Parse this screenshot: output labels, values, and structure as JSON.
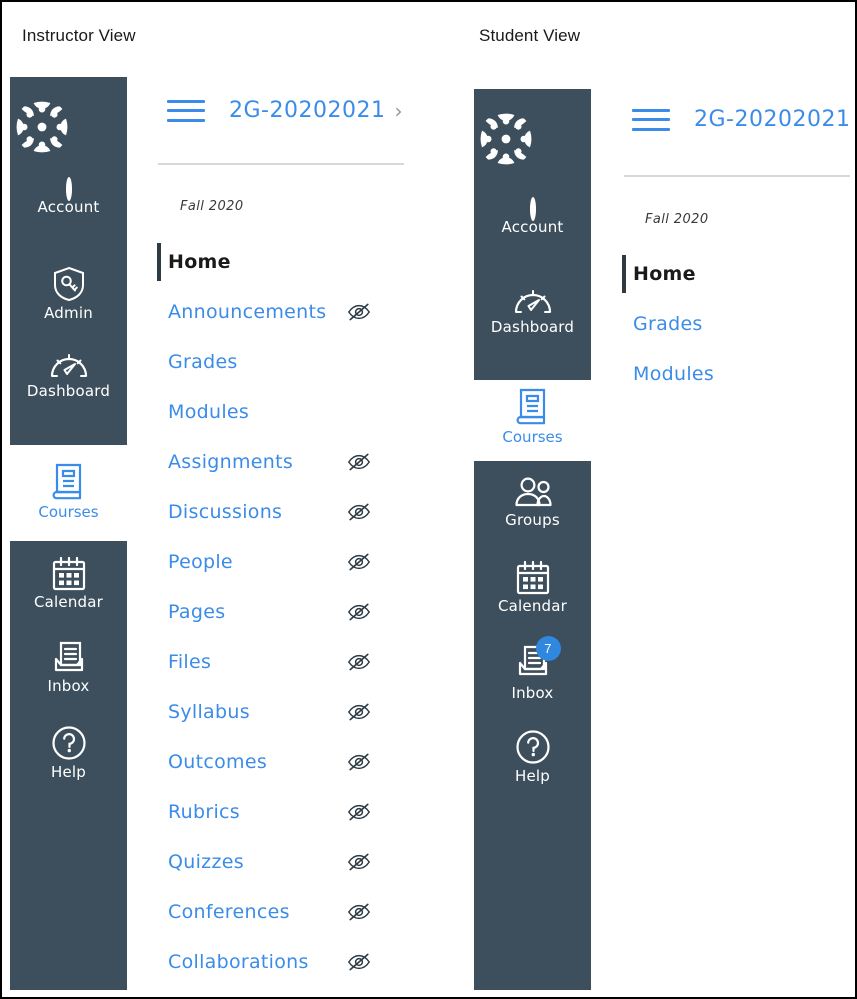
{
  "headings": {
    "instructor": "Instructor View",
    "student": "Student View"
  },
  "colors": {
    "nav_dark": "#3d4f5d",
    "link_blue": "#3b8ce8",
    "active_text": "#1a1a1a",
    "rule": "#d5d9dd",
    "badge": "#2f87e0",
    "chevron": "#8f9499"
  },
  "instructor": {
    "global_nav": {
      "logo_icon": "canvas-logo-icon",
      "items": [
        {
          "label": "Account",
          "icon": "avatar-icon",
          "active": false
        },
        {
          "label": "Admin",
          "icon": "shield-key-icon",
          "active": false
        },
        {
          "label": "Dashboard",
          "icon": "gauge-icon",
          "active": false
        },
        {
          "label": "Courses",
          "icon": "book-icon",
          "active": true
        },
        {
          "label": "Calendar",
          "icon": "calendar-icon",
          "active": false
        },
        {
          "label": "Inbox",
          "icon": "inbox-icon",
          "active": false
        },
        {
          "label": "Help",
          "icon": "question-circle-icon",
          "active": false
        }
      ]
    },
    "course": {
      "menu_icon": "hamburger-icon",
      "title": "2G-20202021",
      "chevron_icon": "chevron-right-icon",
      "has_chevron": true,
      "term": "Fall 2020",
      "nav": [
        {
          "label": "Home",
          "active": true,
          "hidden_icon": false
        },
        {
          "label": "Announcements",
          "active": false,
          "hidden_icon": true
        },
        {
          "label": "Grades",
          "active": false,
          "hidden_icon": false
        },
        {
          "label": "Modules",
          "active": false,
          "hidden_icon": false
        },
        {
          "label": "Assignments",
          "active": false,
          "hidden_icon": true
        },
        {
          "label": "Discussions",
          "active": false,
          "hidden_icon": true
        },
        {
          "label": "People",
          "active": false,
          "hidden_icon": true
        },
        {
          "label": "Pages",
          "active": false,
          "hidden_icon": true
        },
        {
          "label": "Files",
          "active": false,
          "hidden_icon": true
        },
        {
          "label": "Syllabus",
          "active": false,
          "hidden_icon": true
        },
        {
          "label": "Outcomes",
          "active": false,
          "hidden_icon": true
        },
        {
          "label": "Rubrics",
          "active": false,
          "hidden_icon": true
        },
        {
          "label": "Quizzes",
          "active": false,
          "hidden_icon": true
        },
        {
          "label": "Conferences",
          "active": false,
          "hidden_icon": true
        },
        {
          "label": "Collaborations",
          "active": false,
          "hidden_icon": true
        }
      ]
    }
  },
  "student": {
    "global_nav": {
      "logo_icon": "canvas-logo-icon",
      "items": [
        {
          "label": "Account",
          "icon": "avatar-icon",
          "active": false
        },
        {
          "label": "Dashboard",
          "icon": "gauge-icon",
          "active": false
        },
        {
          "label": "Courses",
          "icon": "book-icon",
          "active": true
        },
        {
          "label": "Groups",
          "icon": "groups-icon",
          "active": false
        },
        {
          "label": "Calendar",
          "icon": "calendar-icon",
          "active": false
        },
        {
          "label": "Inbox",
          "icon": "inbox-icon",
          "active": false,
          "badge": "7"
        },
        {
          "label": "Help",
          "icon": "question-circle-icon",
          "active": false
        }
      ]
    },
    "course": {
      "menu_icon": "hamburger-icon",
      "title": "2G-20202021",
      "has_chevron": false,
      "term": "Fall 2020",
      "nav": [
        {
          "label": "Home",
          "active": true,
          "hidden_icon": false
        },
        {
          "label": "Grades",
          "active": false,
          "hidden_icon": false
        },
        {
          "label": "Modules",
          "active": false,
          "hidden_icon": false
        }
      ]
    }
  }
}
